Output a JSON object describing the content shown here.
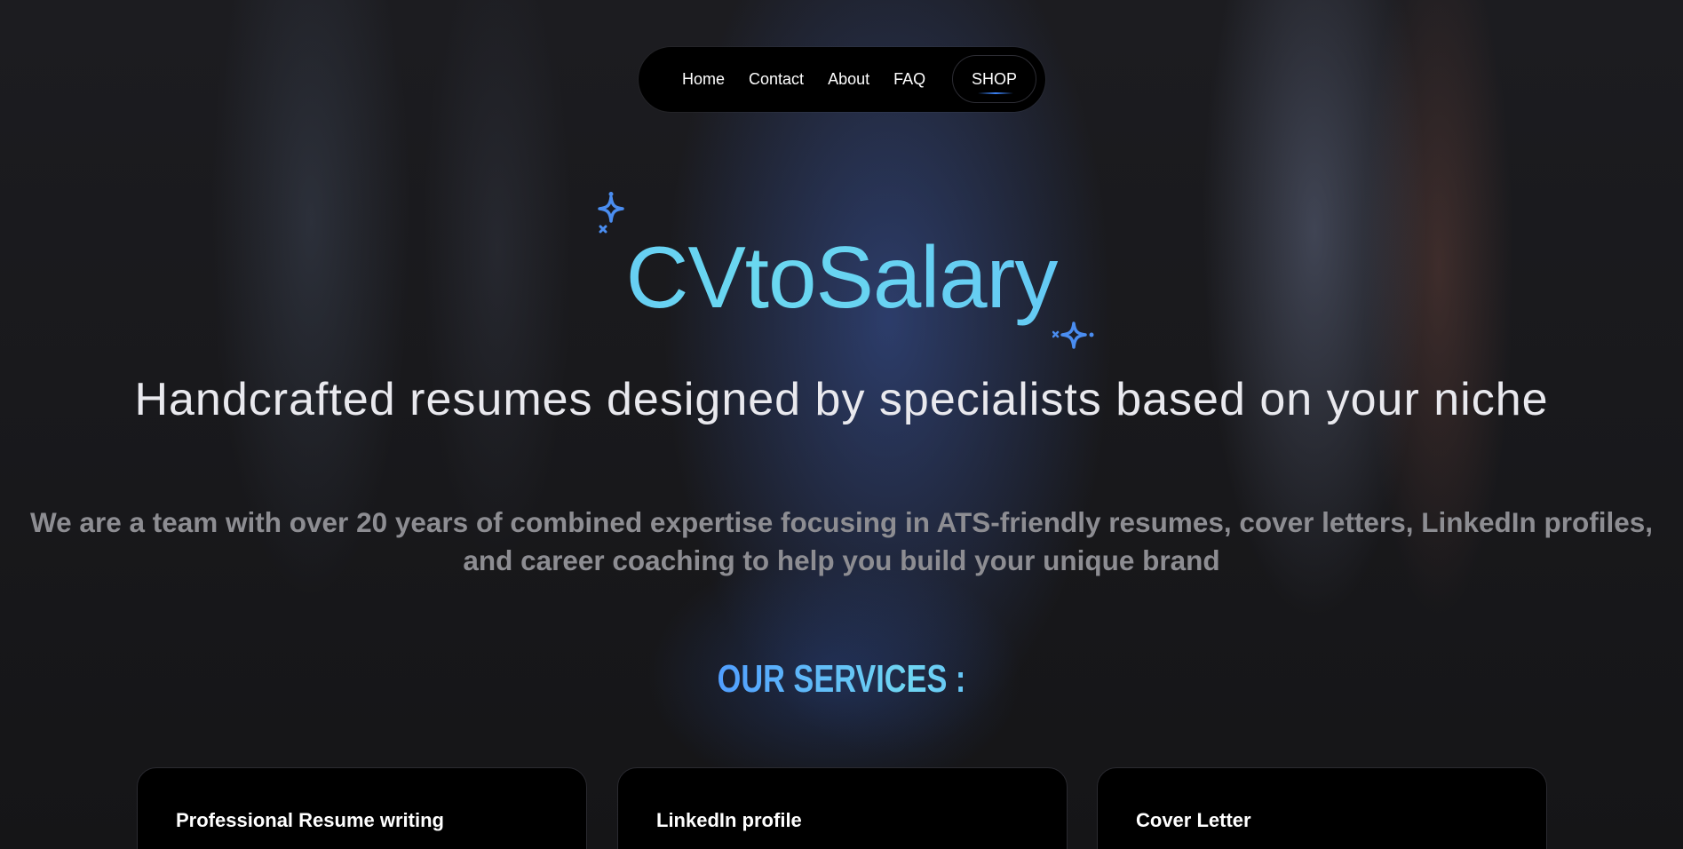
{
  "nav": {
    "items": [
      {
        "label": "Home"
      },
      {
        "label": "Contact"
      },
      {
        "label": "About"
      },
      {
        "label": "FAQ"
      }
    ],
    "shop_label": "SHOP"
  },
  "hero": {
    "brand": "CVtoSalary",
    "tagline": "Handcrafted resumes designed by specialists based on your niche",
    "description": "We are a team with over 20 years of combined expertise focusing in ATS-friendly resumes, cover letters, LinkedIn profiles, and career coaching to help you build your unique brand"
  },
  "services": {
    "title": "OUR SERVICES :",
    "cards": [
      {
        "title": "Professional Resume writing"
      },
      {
        "title": "LinkedIn profile"
      },
      {
        "title": "Cover Letter"
      }
    ]
  },
  "colors": {
    "accent": "#4f9cff",
    "accent_light": "#6ad8f0",
    "nav_bg": "#000000",
    "card_bg": "#000000",
    "text_muted": "#8d8d92"
  },
  "icons": {
    "sparkle_top": "sparkle-icon",
    "sparkle_bottom": "sparkle-icon"
  }
}
